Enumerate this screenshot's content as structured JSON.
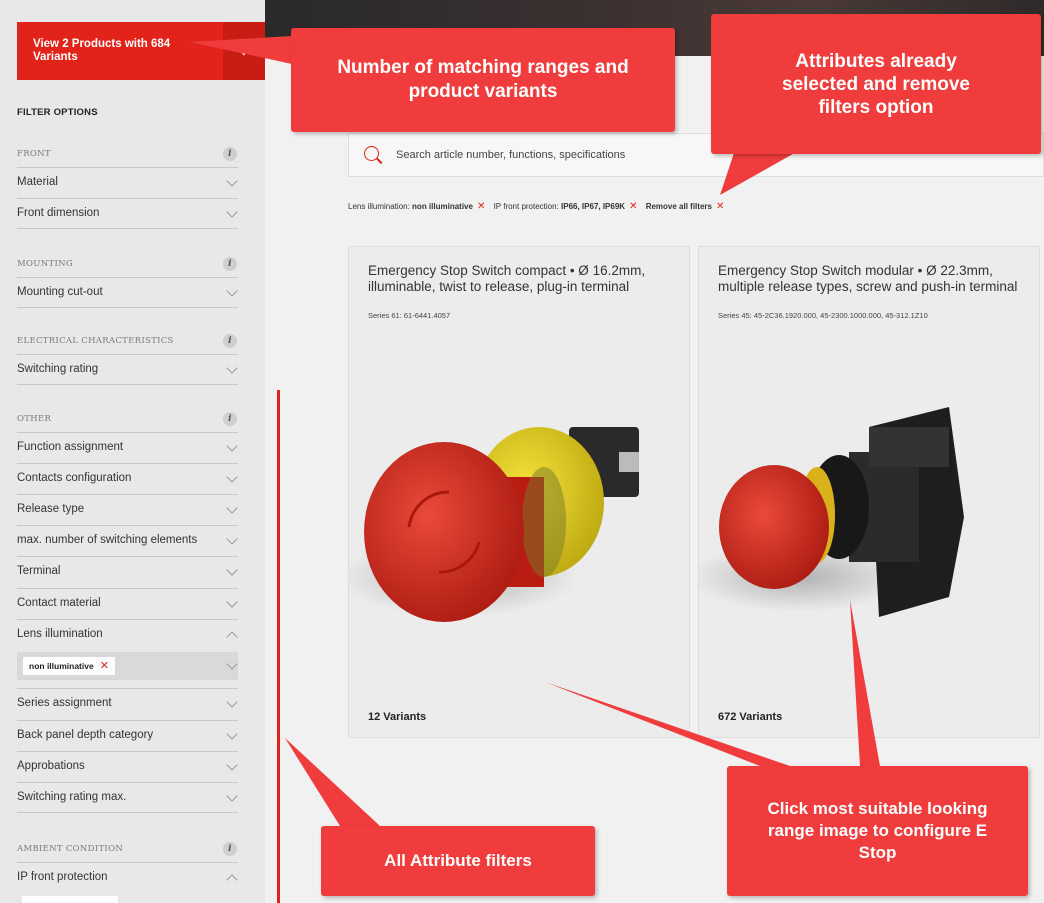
{
  "cta": {
    "label": "View 2 Products with 684 Variants",
    "arrow": "↓"
  },
  "sidebar": {
    "filter_title": "FILTER OPTIONS",
    "sections": [
      {
        "heading": "FRONT",
        "info": "i",
        "items": [
          "Material",
          "Front dimension"
        ]
      },
      {
        "heading": "MOUNTING",
        "info": "i",
        "items": [
          "Mounting cut-out"
        ]
      },
      {
        "heading": "ELECTRICAL CHARACTERISTICS",
        "info": "i",
        "items": [
          "Switching rating"
        ]
      },
      {
        "heading": "OTHER",
        "info": "i",
        "items": [
          "Function assignment",
          "Contacts configuration",
          "Release type",
          "max. number of switching elements",
          "Terminal",
          "Contact material",
          "Lens illumination",
          "Series assignment",
          "Back panel depth category",
          "Approbations",
          "Switching rating max."
        ]
      },
      {
        "heading": "AMBIENT CONDITION",
        "info": "i",
        "items": [
          "IP front protection"
        ]
      }
    ],
    "lens_chip": "non illuminative",
    "chip_remove": "✕"
  },
  "search": {
    "placeholder": "Search article number, functions, specifications"
  },
  "active_filters": [
    {
      "label": "Lens illumination: ",
      "value": "non illuminative"
    },
    {
      "label": "IP front protection: ",
      "value": "IP66, IP67, IP69K"
    }
  ],
  "remove_all": "Remove all filters",
  "remove_x": "✕",
  "products": [
    {
      "title": "Emergency Stop Switch compact • Ø 16.2mm, illuminable, twist to release, plug-in terminal",
      "series": "Series 61: 61-6441.4057",
      "variants": "12 Variants"
    },
    {
      "title": "Emergency Stop Switch modular • Ø 22.3mm, multiple release types, screw and push-in terminal",
      "series": "Series 45: 45-2C36.1920.000, 45-2300.1000.000, 45-312.1Z10",
      "variants": "672 Variants"
    }
  ],
  "callouts": {
    "matching": "Number of matching  ranges and product variants",
    "selected": "Attributes already selected and remove filters option",
    "all_filters": "All Attribute filters",
    "click_image": "Click most suitable looking  range image to configure E Stop"
  },
  "colors": {
    "brand_red": "#e2231a",
    "callout_red": "#f03c3c"
  }
}
